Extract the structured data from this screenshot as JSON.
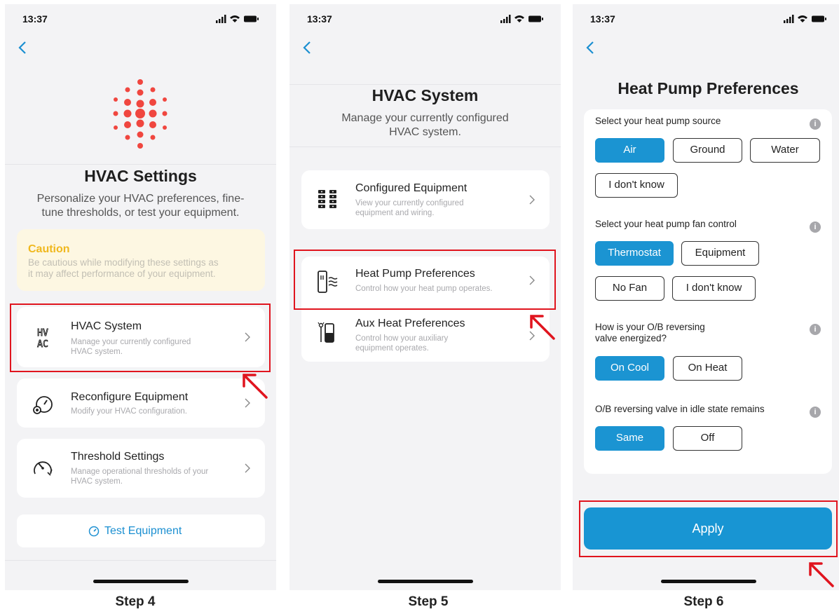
{
  "colors": {
    "accent": "#1b94d2",
    "highlight": "#e0141e",
    "caution": "#f0b81e",
    "logo": "#f0463f"
  },
  "screens": [
    {
      "time": "13:37",
      "title": "HVAC Settings",
      "subtitle_line1": "Personalize your HVAC preferences, fine-",
      "subtitle_line2": "tune thresholds, or test your equipment.",
      "caution": {
        "title": "Caution",
        "text_line1": "Be cautious while modifying these settings as",
        "text_line2": "it may affect performance of your equipment."
      },
      "items": [
        {
          "title": "HVAC System",
          "sub_line1": "Manage your currently configured",
          "sub_line2": "HVAC system.",
          "icon": "hvac-text-icon"
        },
        {
          "title": "Reconfigure Equipment",
          "sub_line1": "Modify your HVAC configuration.",
          "sub_line2": "",
          "icon": "gauge-icon"
        },
        {
          "title": "Threshold Settings",
          "sub_line1": "Manage operational thresholds of your",
          "sub_line2": "HVAC system.",
          "icon": "threshold-icon"
        }
      ],
      "test_button": "Test Equipment",
      "step_label": "Step 4"
    },
    {
      "time": "13:37",
      "title": "HVAC System",
      "subtitle_line1": "Manage your currently configured",
      "subtitle_line2": "HVAC system.",
      "items": [
        {
          "title": "Configured Equipment",
          "sub_line1": "View your currently configured",
          "sub_line2": "equipment and wiring.",
          "icon": "equipment-grid-icon"
        },
        {
          "title": "Heat Pump Preferences",
          "sub_line1": "Control how your heat pump operates.",
          "sub_line2": "",
          "icon": "heat-pump-icon"
        },
        {
          "title": "Aux Heat Preferences",
          "sub_line1": "Control how your auxiliary",
          "sub_line2": "equipment operates.",
          "icon": "aux-heat-icon"
        }
      ],
      "step_label": "Step 5"
    },
    {
      "time": "13:37",
      "title": "Heat Pump Preferences",
      "questions": [
        {
          "label_line1": "Select your heat pump source",
          "label_line2": "",
          "options": [
            "Air",
            "Ground",
            "Water",
            "I don't know"
          ],
          "selected": "Air"
        },
        {
          "label_line1": "Select your heat pump fan control",
          "label_line2": "",
          "options": [
            "Thermostat",
            "Equipment",
            "No Fan",
            "I don't know"
          ],
          "selected": "Thermostat"
        },
        {
          "label_line1": "How is your O/B reversing",
          "label_line2": "valve energized?",
          "options": [
            "On Cool",
            "On Heat"
          ],
          "selected": "On Cool"
        },
        {
          "label_line1": "O/B reversing valve in idle state remains",
          "label_line2": "",
          "options": [
            "Same",
            "Off"
          ],
          "selected": "Same"
        }
      ],
      "info_glyph": "i",
      "apply_button": "Apply",
      "step_label": "Step 6"
    }
  ]
}
